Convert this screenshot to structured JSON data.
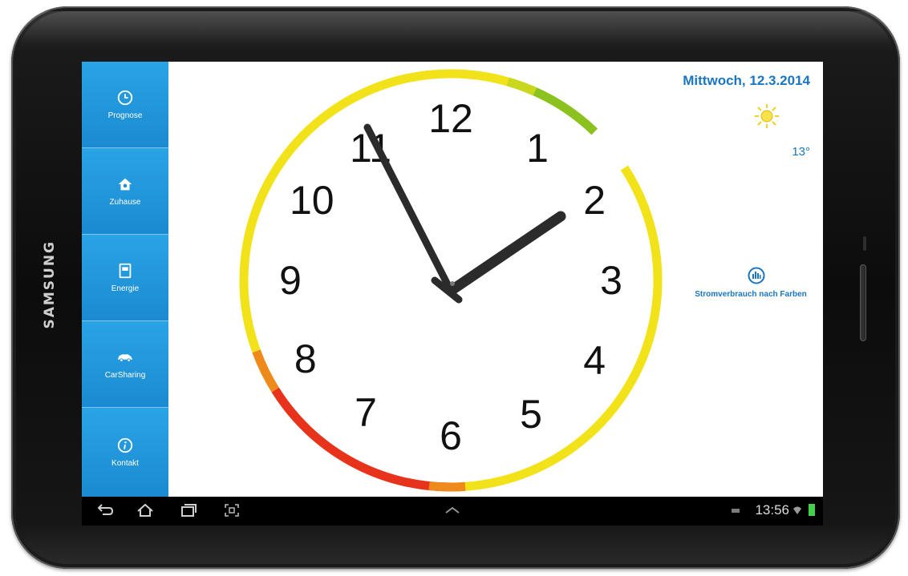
{
  "device": {
    "brand": "SAMSUNG"
  },
  "sidebar": {
    "items": [
      {
        "label": "Prognose",
        "icon": "clock-icon"
      },
      {
        "label": "Zuhause",
        "icon": "house-icon"
      },
      {
        "label": "Energie",
        "icon": "meter-icon"
      },
      {
        "label": "CarSharing",
        "icon": "car-icon"
      },
      {
        "label": "Kontakt",
        "icon": "info-icon"
      }
    ]
  },
  "header": {
    "date": "Mittwoch, 12.3.2014"
  },
  "weather": {
    "icon": "sun-icon",
    "temperature": "13°"
  },
  "clock": {
    "numerals": [
      "12",
      "1",
      "2",
      "3",
      "4",
      "5",
      "6",
      "7",
      "8",
      "9",
      "10",
      "11"
    ],
    "time_shown": "1:56",
    "ring_colors": {
      "green": "#8cc21f",
      "yellow": "#f2e21a",
      "red": "#e8331c"
    }
  },
  "legend": {
    "label": "Stromverbrauch nach Farben",
    "icon": "consumption-bars-icon"
  },
  "statusbar": {
    "time": "13:56"
  },
  "accent_color": "#1f8fd6"
}
